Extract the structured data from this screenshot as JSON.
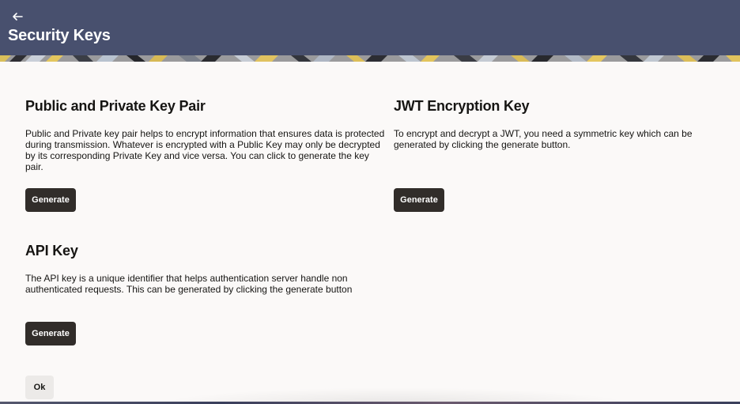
{
  "header": {
    "back_icon": "arrow-left-icon",
    "title": "Security Keys",
    "background_color": "#48506e"
  },
  "sections": {
    "key_pair": {
      "title": "Public and Private Key Pair",
      "description": "Public and Private key pair helps to encrypt information that ensures data is protected during transmission. Whatever is encrypted with a Public Key may only be decrypted by its corresponding Private Key and vice versa. You can click to generate the key pair.",
      "button_label": "Generate"
    },
    "jwt": {
      "title": "JWT Encryption Key",
      "description": "To encrypt and decrypt a JWT, you need a symmetric key which can be generated by clicking the generate button.",
      "button_label": "Generate"
    },
    "api_key": {
      "title": "API Key",
      "description": "The API key is a unique identifier that helps authentication server handle non authenticated requests. This can be generated by clicking the generate button",
      "button_label": "Generate"
    }
  },
  "footer": {
    "ok_label": "Ok"
  },
  "colors": {
    "primary_button": "#312d2a",
    "secondary_button": "#eceae8",
    "page_background": "#fbf9f8"
  }
}
